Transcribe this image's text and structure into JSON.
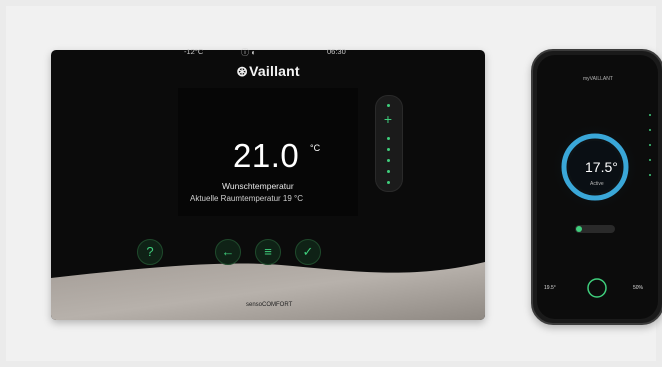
{
  "thermostat": {
    "brand": "Vaillant",
    "outdoor_temp": "-12°C",
    "status_icons": "ⓘ ◐",
    "clock": "06:30",
    "setpoint": "21.0",
    "unit": "°C",
    "setpoint_label": "Wunschtemperatur",
    "room_temp_label": "Aktuelle Raumtemperatur 19 °C",
    "model": "sensoCOMFORT",
    "buttons": {
      "help": "?",
      "back": "←",
      "menu": "≡",
      "confirm": "✓"
    }
  },
  "phone": {
    "app_title": "myVAILLANT",
    "temperature": "17.5°",
    "mode_label": "Active",
    "left_reading": "19.5°",
    "right_reading": "50%"
  },
  "colors": {
    "accent": "#3fce7c",
    "ring": "#3aa7d8"
  }
}
